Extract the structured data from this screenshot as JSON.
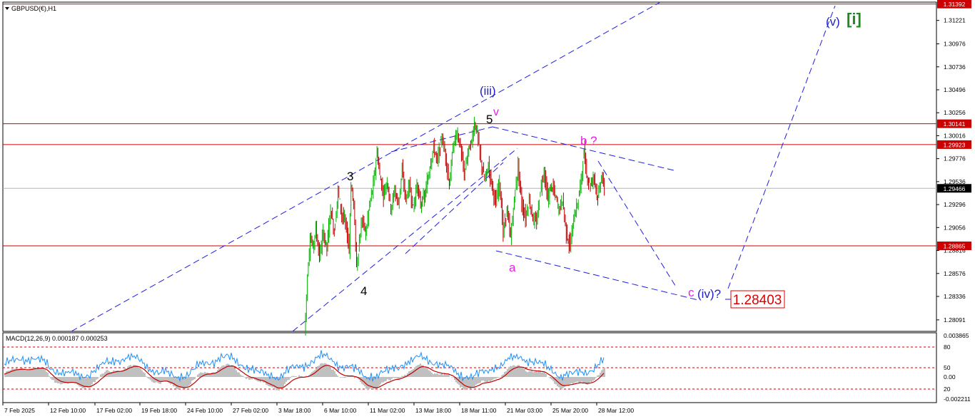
{
  "symbol_title": "GBPUSD(€),H1",
  "macd_title": "MACD(12,26,9) 0.000187 0.000253",
  "colors": {
    "bull": "#00b400",
    "bear": "#c00000",
    "hline": "#cc0000",
    "current": "#b4b4b4",
    "trend": "#1e1ee6",
    "wave_blue": "#1e1ec8",
    "wave_magenta": "#e61ee6",
    "wave_black": "#000000",
    "wave_green": "#1e8c1e",
    "macd_line": "#1e90ff",
    "signal_line": "#c00000",
    "histogram": "#c0c0c0",
    "target_box": "#e00000"
  },
  "chart_data": [
    {
      "type": "candlestick",
      "title": "GBPUSD(€),H1",
      "ylim": [
        1.27971,
        1.31412
      ],
      "price_ticks": [
        "1.31221",
        "1.30976",
        "1.30736",
        "1.30496",
        "1.30256",
        "1.30016",
        "1.29776",
        "1.29536",
        "1.29296",
        "1.29056",
        "1.28816",
        "1.28576",
        "1.28336",
        "1.28091"
      ],
      "time_labels": [
        "7 Feb 2025",
        "12 Feb 10:00",
        "17 Feb 02:00",
        "19 Feb 18:00",
        "24 Feb 10:00",
        "27 Feb 02:00",
        "3 Mar 18:00",
        "6 Mar 10:00",
        "11 Mar 02:00",
        "13 Mar 18:00",
        "18 Mar 11:00",
        "21 Mar 03:00",
        "25 Mar 20:00",
        "28 Mar 12:00"
      ],
      "horizontal_levels": [
        {
          "label": "1.31392",
          "value": 1.31392,
          "style": "red"
        },
        {
          "label": "1.30141",
          "value": 1.30141,
          "style": "red"
        },
        {
          "label": "1.29923",
          "value": 1.29923,
          "style": "red"
        },
        {
          "label": "1.29466",
          "value": 1.29466,
          "style": "current"
        },
        {
          "label": "1.28865",
          "value": 1.28865,
          "style": "red"
        }
      ],
      "price_path": [
        [
          0,
          1.2795
        ],
        [
          3,
          1.2855
        ],
        [
          6,
          1.2895
        ],
        [
          9,
          1.2885
        ],
        [
          12,
          1.2905
        ],
        [
          16,
          1.2875
        ],
        [
          20,
          1.29
        ],
        [
          24,
          1.2885
        ],
        [
          28,
          1.2925
        ],
        [
          32,
          1.29
        ],
        [
          36,
          1.2945
        ],
        [
          40,
          1.292
        ],
        [
          44,
          1.291
        ],
        [
          48,
          1.2885
        ],
        [
          50,
          1.295
        ],
        [
          53,
          1.293
        ],
        [
          56,
          1.2865
        ],
        [
          59,
          1.289
        ],
        [
          62,
          1.2915
        ],
        [
          66,
          1.29
        ],
        [
          70,
          1.293
        ],
        [
          74,
          1.295
        ],
        [
          78,
          1.2985
        ],
        [
          81,
          1.296
        ],
        [
          85,
          1.294
        ],
        [
          89,
          1.2955
        ],
        [
          93,
          1.2925
        ],
        [
          97,
          1.2945
        ],
        [
          101,
          1.293
        ],
        [
          105,
          1.2965
        ],
        [
          109,
          1.2935
        ],
        [
          113,
          1.295
        ],
        [
          117,
          1.2925
        ],
        [
          121,
          1.295
        ],
        [
          125,
          1.293
        ],
        [
          130,
          1.294
        ],
        [
          135,
          1.297
        ],
        [
          139,
          1.299
        ],
        [
          143,
          1.2975
        ],
        [
          148,
          1.3
        ],
        [
          152,
          1.298
        ],
        [
          156,
          1.295
        ],
        [
          160,
          1.299
        ],
        [
          164,
          1.3005
        ],
        [
          168,
          1.299
        ],
        [
          172,
          1.296
        ],
        [
          176,
          1.2985
        ],
        [
          180,
          1.2995
        ],
        [
          183,
          1.3015
        ],
        [
          186,
          1.3005
        ],
        [
          190,
          1.2975
        ],
        [
          194,
          1.2955
        ],
        [
          198,
          1.297
        ],
        [
          202,
          1.295
        ],
        [
          206,
          1.293
        ],
        [
          210,
          1.2955
        ],
        [
          214,
          1.29
        ],
        [
          218,
          1.2925
        ],
        [
          222,
          1.2895
        ],
        [
          226,
          1.2935
        ],
        [
          230,
          1.297
        ],
        [
          234,
          1.293
        ],
        [
          238,
          1.2915
        ],
        [
          242,
          1.2935
        ],
        [
          246,
          1.2915
        ],
        [
          250,
          1.291
        ],
        [
          254,
          1.2945
        ],
        [
          258,
          1.2965
        ],
        [
          262,
          1.2935
        ],
        [
          266,
          1.295
        ],
        [
          270,
          1.294
        ],
        [
          274,
          1.2925
        ],
        [
          278,
          1.2935
        ],
        [
          282,
          1.29
        ],
        [
          286,
          1.2885
        ],
        [
          290,
          1.2915
        ],
        [
          294,
          1.293
        ],
        [
          298,
          1.2955
        ],
        [
          301,
          1.2985
        ],
        [
          304,
          1.296
        ],
        [
          308,
          1.295
        ],
        [
          312,
          1.296
        ],
        [
          316,
          1.2935
        ],
        [
          320,
          1.296
        ],
        [
          323,
          1.2945
        ]
      ]
    },
    {
      "type": "line",
      "title": "MACD(12,26,9) 0.000187 0.000253",
      "ylim": [
        -0.002211,
        0.003865
      ],
      "value_ticks": [
        "0.003865",
        "80",
        "50",
        "0.00",
        "20",
        "-0.002211"
      ],
      "levels": [
        80,
        50,
        20
      ]
    }
  ],
  "annotations": [
    {
      "text": "(iii)",
      "color": "wave_blue"
    },
    {
      "text": "5",
      "color": "wave_black"
    },
    {
      "text": "v",
      "color": "wave_magenta"
    },
    {
      "text": "3",
      "color": "wave_black"
    },
    {
      "text": "4",
      "color": "wave_black"
    },
    {
      "text": "b ?",
      "color": "wave_magenta"
    },
    {
      "text": "a",
      "color": "wave_magenta"
    },
    {
      "text": "c",
      "color": "wave_magenta"
    },
    {
      "text": "(iv)?",
      "color": "wave_blue"
    },
    {
      "text": "(v)",
      "color": "wave_blue"
    },
    {
      "text": "[i]",
      "color": "wave_green"
    },
    {
      "text": "1.28403",
      "color": "target_box"
    }
  ]
}
